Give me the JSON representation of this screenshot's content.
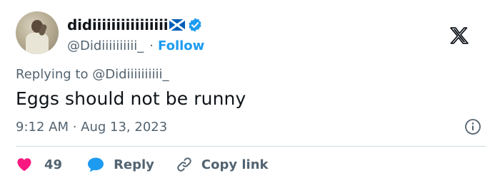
{
  "author": {
    "display_name": "didiiiiiiiiiiiiiiii",
    "handle": "@Didiiiiiiiiii_",
    "separator": "·",
    "follow_label": "Follow"
  },
  "tweet": {
    "replying_prefix": "Replying to",
    "replying_to": "@Didiiiiiiiiii_",
    "text": "Eggs should not be runny",
    "timestamp": "9:12 AM · Aug 13, 2023"
  },
  "actions": {
    "like_count": "49",
    "reply_label": "Reply",
    "copy_link_label": "Copy link"
  },
  "icons": {
    "flag": "scotland-flag-icon",
    "verified": "verified-badge-icon",
    "logo": "x-logo-icon",
    "info": "info-icon",
    "like": "heart-icon",
    "reply": "reply-bubble-icon",
    "copy": "link-icon"
  },
  "colors": {
    "accent": "#1d9bf0",
    "like": "#f91880",
    "secondary_text": "#536471",
    "primary_text": "#0f1419",
    "divider": "#cfd9de",
    "flag_blue": "#005eb8"
  }
}
